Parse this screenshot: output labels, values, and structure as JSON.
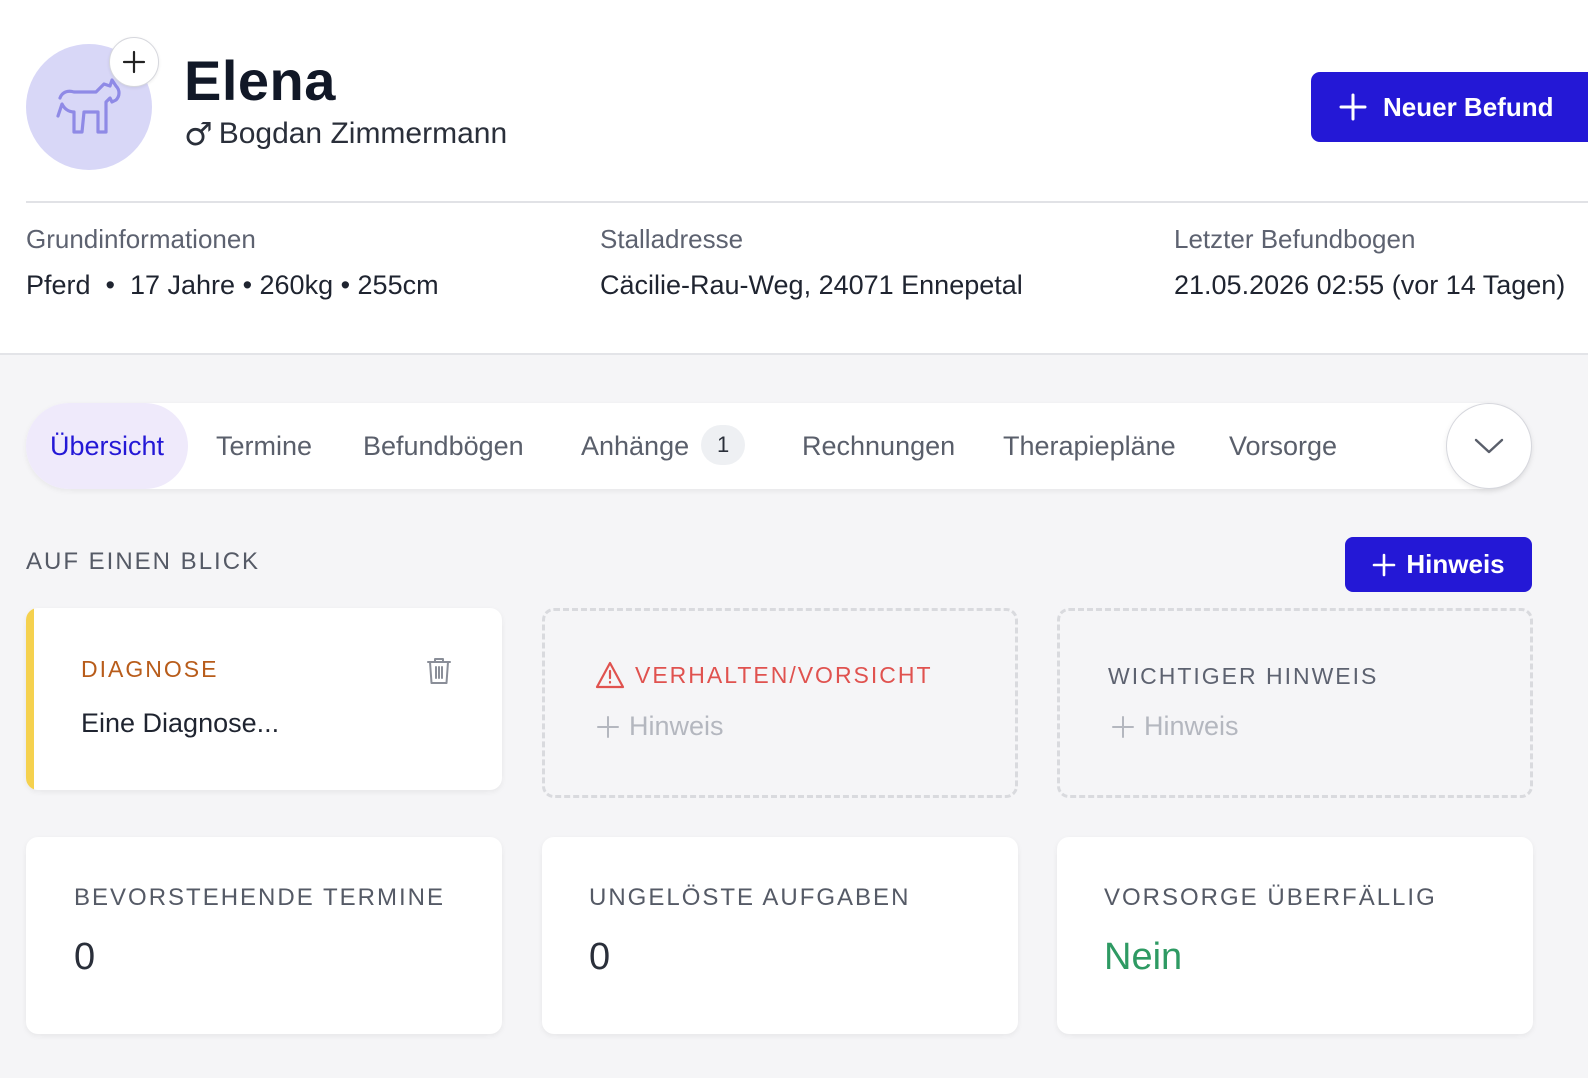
{
  "header": {
    "patient_name": "Elena",
    "owner_symbol": "♂",
    "owner_name": "Bogdan Zimmermann",
    "new_report_label": "Neuer Befund",
    "avatar_icon": "horse-icon"
  },
  "info": {
    "basic_label": "Grundinformationen",
    "basic_value": "Pferd  •  17 Jahre • 260kg • 255cm",
    "stable_label": "Stalladresse",
    "stable_value": "Cäcilie-Rau-Weg, 24071 Ennepetal",
    "last_report_label": "Letzter Befundbogen",
    "last_report_value": "21.05.2026 02:55 (vor 14 Tagen)"
  },
  "tabs": [
    {
      "label": "Übersicht",
      "active": true
    },
    {
      "label": "Termine"
    },
    {
      "label": "Befundbögen"
    },
    {
      "label": "Anhänge",
      "badge": "1"
    },
    {
      "label": "Rechnungen"
    },
    {
      "label": "Therapiepläne"
    },
    {
      "label": "Vorsorge"
    }
  ],
  "overview": {
    "section_title": "AUF EINEN BLICK",
    "add_note_label": "Hinweis",
    "diagnosis": {
      "label": "DIAGNOSE",
      "text": "Eine Diagnose..."
    },
    "behavior": {
      "label": "VERHALTEN/VORSICHT",
      "hint": "Hinweis"
    },
    "important": {
      "label": "WICHTIGER HINWEIS",
      "hint": "Hinweis"
    }
  },
  "stats": {
    "upcoming_label": "BEVORSTEHENDE TERMINE",
    "upcoming_value": "0",
    "open_tasks_label": "UNGELÖSTE AUFGABEN",
    "open_tasks_value": "0",
    "overdue_label": "VORSORGE ÜBERFÄLLIG",
    "overdue_value": "Nein"
  },
  "colors": {
    "primary": "#2418d6",
    "diagnosis_label": "#b85c1a",
    "diagnosis_accent": "#f5d14e",
    "behavior_label": "#e0524f",
    "success": "#2e9a63"
  }
}
